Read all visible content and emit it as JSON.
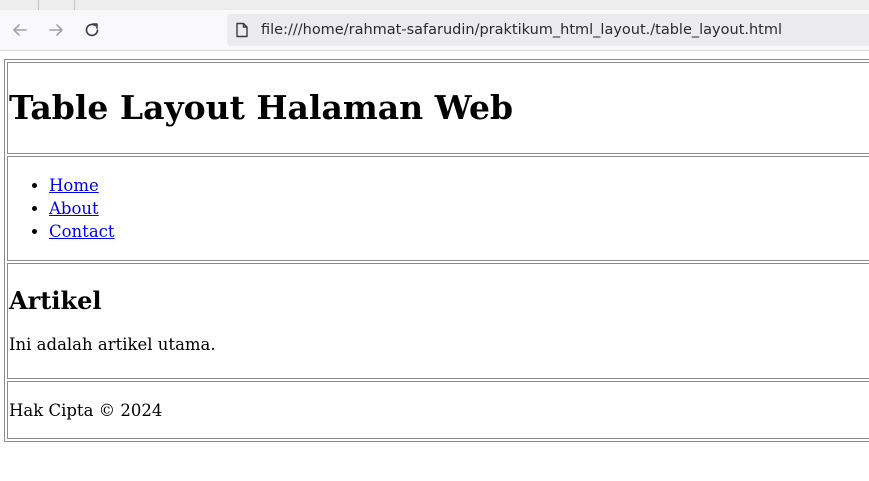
{
  "browser": {
    "url": "file:///home/rahmat-safarudin/praktikum_html_layout./table_layout.html",
    "icons": {
      "back": "arrow-left",
      "forward": "arrow-right",
      "reload": "reload",
      "page": "page"
    }
  },
  "page": {
    "title": "Table Layout Halaman Web",
    "nav": {
      "items": [
        {
          "label": "Home"
        },
        {
          "label": "About"
        },
        {
          "label": "Contact"
        }
      ],
      "link_color": "#0000ee"
    },
    "article": {
      "title": "Artikel",
      "text": "Ini adalah artikel utama."
    },
    "footer": {
      "text": "Hak Cipta © 2024"
    }
  }
}
